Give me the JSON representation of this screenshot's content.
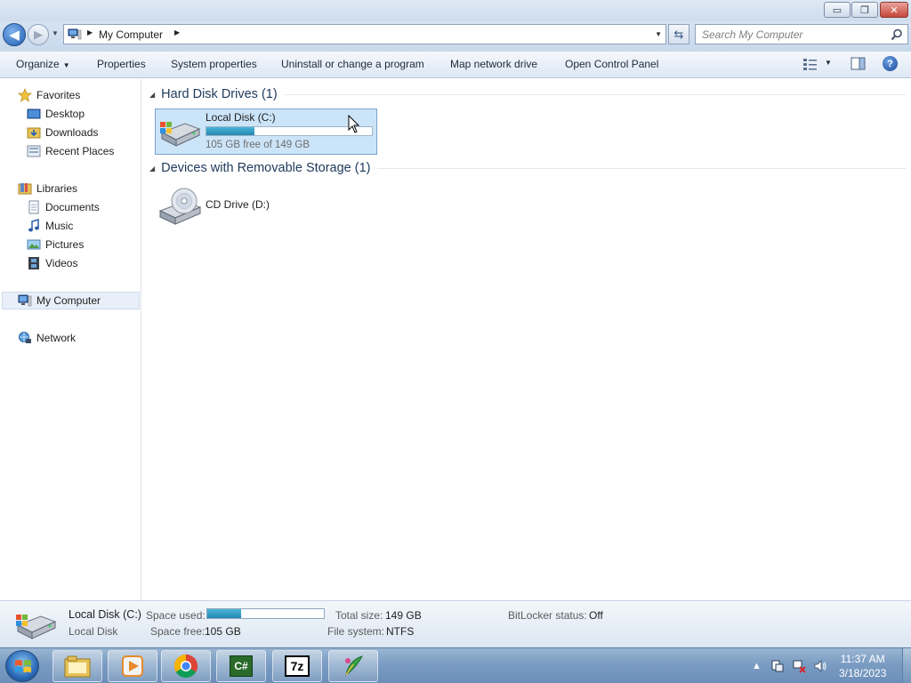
{
  "window": {
    "minimize_glyph": "▭",
    "maximize_glyph": "❐",
    "close_glyph": "✕"
  },
  "address_bar": {
    "path_segments": [
      "My Computer"
    ],
    "search_placeholder": "Search My Computer"
  },
  "toolbar": {
    "organize": "Organize",
    "properties": "Properties",
    "system_properties": "System properties",
    "uninstall": "Uninstall or change a program",
    "map_network_drive": "Map network drive",
    "open_control_panel": "Open Control Panel",
    "help_glyph": "?"
  },
  "nav_pane": {
    "favorites": {
      "label": "Favorites",
      "items": [
        "Desktop",
        "Downloads",
        "Recent Places"
      ]
    },
    "libraries": {
      "label": "Libraries",
      "items": [
        "Documents",
        "Music",
        "Pictures",
        "Videos"
      ]
    },
    "computer": "My Computer",
    "network": "Network"
  },
  "groups": {
    "hard_disk": {
      "title": "Hard Disk Drives (1)",
      "drive": {
        "name": "Local Disk (C:)",
        "free_text": "105 GB free of 149 GB",
        "used_fraction": 0.29
      }
    },
    "removable": {
      "title": "Devices with Removable Storage (1)",
      "drive": {
        "name": "CD Drive (D:)"
      }
    }
  },
  "details_pane": {
    "name": "Local Disk (C:)",
    "type": "Local Disk",
    "space_used_label": "Space used:",
    "space_used_fraction": 0.29,
    "space_free_label": "Space free:",
    "space_free_value": "105 GB",
    "total_size_label": "Total size:",
    "total_size_value": "149 GB",
    "file_system_label": "File system:",
    "file_system_value": "NTFS",
    "bitlocker_label": "BitLocker status:",
    "bitlocker_value": "Off"
  },
  "taskbar": {
    "apps": [
      "file-explorer",
      "media-player",
      "chrome",
      "csharp-ide",
      "7zip",
      "sketch-app"
    ],
    "csharp_glyph": "C#",
    "sevenzip_glyph": "7z",
    "clock_time": "11:37 AM",
    "clock_date": "3/18/2023"
  },
  "colors": {
    "selection": "#cce4f8",
    "progress": "#2688b3",
    "taskbar": "#7a9cc2"
  }
}
